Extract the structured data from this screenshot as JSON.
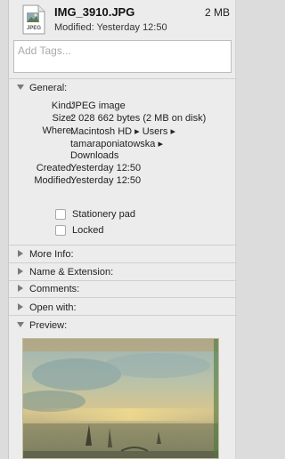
{
  "file": {
    "name": "IMG_3910.JPG",
    "size": "2 MB",
    "modified": "Modified:  Yesterday 12:50",
    "icon": "jpeg-file-icon",
    "icon_label": "JPEG"
  },
  "tags": {
    "placeholder": "Add Tags..."
  },
  "general": {
    "title": "General:",
    "expanded": true,
    "rows": [
      {
        "label": "Kind:",
        "value": "JPEG image"
      },
      {
        "label": "Size:",
        "value": "2 028 662 bytes (2 MB on disk)"
      },
      {
        "label": "Where:",
        "value_lines": [
          "Macintosh HD ▸ Users ▸",
          "tamaraponiatowska ▸",
          "Downloads"
        ]
      },
      {
        "label": "Created:",
        "value": "Yesterday 12:50"
      },
      {
        "label": "Modified:",
        "value": "Yesterday 12:50"
      }
    ],
    "stationery_label": "Stationery pad",
    "stationery_checked": false,
    "locked_label": "Locked",
    "locked_checked": false
  },
  "sections": [
    {
      "title": "More Info:",
      "expanded": false
    },
    {
      "title": "Name & Extension:",
      "expanded": false
    },
    {
      "title": "Comments:",
      "expanded": false
    },
    {
      "title": "Open with:",
      "expanded": false
    },
    {
      "title": "Preview:",
      "expanded": true
    }
  ],
  "colors": {
    "panel_bg": "#ececec",
    "triangle": "#7a7a7a"
  }
}
